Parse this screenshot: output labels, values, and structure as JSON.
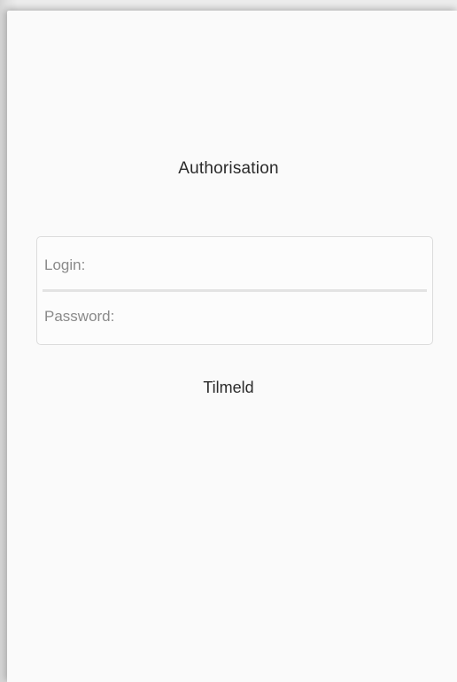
{
  "screen": {
    "title": "Authorisation"
  },
  "form": {
    "login": {
      "placeholder": "Login:",
      "value": ""
    },
    "password": {
      "placeholder": "Password:",
      "value": ""
    },
    "submit_label": "Tilmeld"
  }
}
